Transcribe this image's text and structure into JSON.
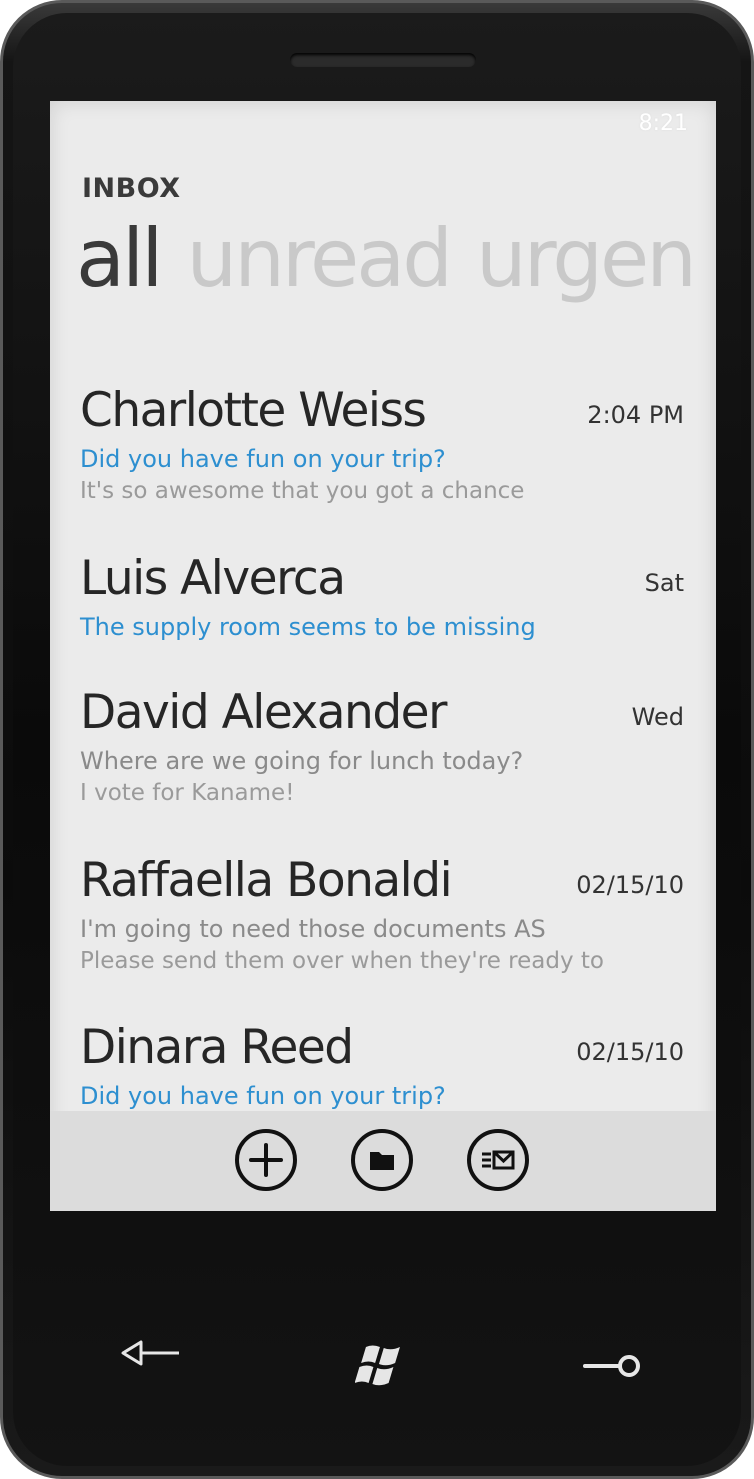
{
  "status_bar": {
    "time": "8:21"
  },
  "header": {
    "title": "INBOX"
  },
  "pivot": {
    "items": [
      {
        "label": "all",
        "active": true
      },
      {
        "label": "unread",
        "active": false
      },
      {
        "label": "urgen",
        "active": false
      }
    ]
  },
  "messages": [
    {
      "sender": "Charlotte Weiss",
      "date": "2:04 PM",
      "subject": "Did you have fun on your trip?",
      "preview": "It's so awesome that you got a chance",
      "unread": true
    },
    {
      "sender": "Luis Alverca",
      "date": "Sat",
      "subject": "The supply room seems to be missing",
      "preview": "",
      "unread": true
    },
    {
      "sender": "David Alexander",
      "date": "Wed",
      "subject": "Where are we going for lunch today?",
      "preview": "I vote for Kaname!",
      "unread": false
    },
    {
      "sender": "Raffaella Bonaldi",
      "date": "02/15/10",
      "subject": "I'm going to need those documents AS",
      "preview": "Please send them over when they're ready to",
      "unread": false
    },
    {
      "sender": "Dinara Reed",
      "date": "02/15/10",
      "subject": "Did you have fun on your trip?",
      "preview": "",
      "unread": true
    }
  ],
  "app_bar": {
    "buttons": [
      {
        "icon": "add-icon"
      },
      {
        "icon": "folder-icon"
      },
      {
        "icon": "select-mail-icon"
      }
    ]
  },
  "hardware_buttons": {
    "back": "back-arrow-icon",
    "start": "windows-logo-icon",
    "search": "search-key-icon"
  },
  "colors": {
    "accent": "#2d8fd0",
    "screen_background": "#ebebeb",
    "app_bar_background": "#dcdcdc",
    "primary_text": "#262626",
    "secondary_text": "#9a9a9a",
    "inactive_pivot": "#c9c9c9"
  }
}
